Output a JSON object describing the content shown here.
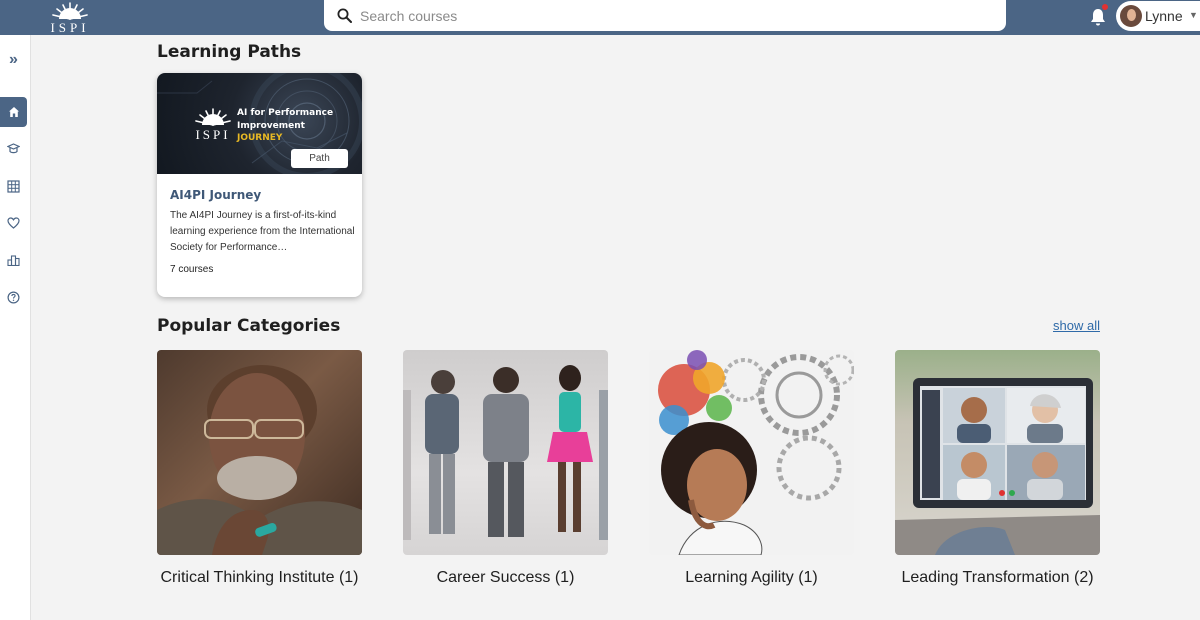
{
  "header": {
    "logo_text": "ISPI",
    "search_placeholder": "Search courses",
    "user_name": "Lynne"
  },
  "sidebar": {
    "items": [
      {
        "icon": "expand-icon"
      },
      {
        "icon": "home-icon",
        "active": true
      },
      {
        "icon": "courses-icon"
      },
      {
        "icon": "catalog-icon"
      },
      {
        "icon": "favorites-icon"
      },
      {
        "icon": "leaderboard-icon"
      },
      {
        "icon": "help-icon"
      }
    ]
  },
  "learning_paths": {
    "title": "Learning Paths",
    "cards": [
      {
        "banner_logo": "ISPI",
        "banner_line1": "AI for Performance",
        "banner_line2": "Improvement",
        "banner_line3": "JOURNEY",
        "badge": "Path",
        "title": "AI4PI Journey",
        "description": "The AI4PI Journey is a first-of-its-kind learning experience from the International Society for Performance…",
        "course_count": "7 courses"
      }
    ]
  },
  "popular_categories": {
    "title": "Popular Categories",
    "show_all": "show all",
    "items": [
      {
        "label": "Critical Thinking Institute (1)"
      },
      {
        "label": "Career Success (1)"
      },
      {
        "label": "Learning Agility (1)"
      },
      {
        "label": "Leading Transformation (2)"
      }
    ]
  },
  "colors": {
    "brand": "#4b6585",
    "link": "#2f6aa8",
    "notification": "#e03131",
    "accent": "#e8b924"
  }
}
